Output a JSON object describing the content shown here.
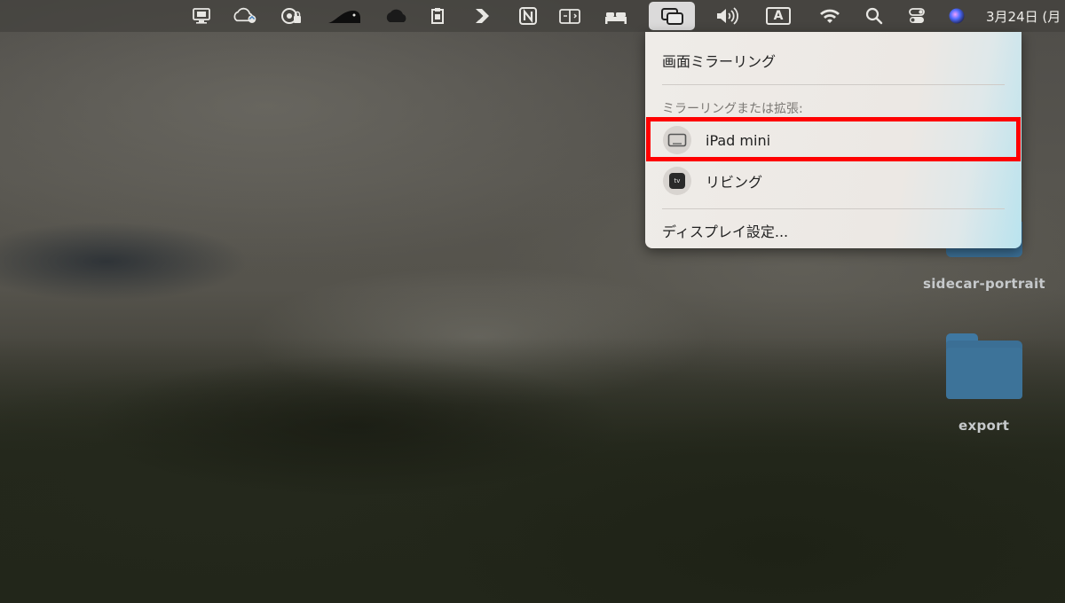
{
  "menubar": {
    "icons": [
      "display-icon",
      "cloud-sync-icon",
      "location-lock-icon",
      "wedge-icon",
      "cloud-icon",
      "clipboard-icon",
      "arrow-icon",
      "notion-icon",
      "split-view-icon",
      "bed-icon",
      "screen-mirroring-icon",
      "volume-icon",
      "input-source-icon",
      "wifi-icon",
      "search-icon",
      "control-center-icon",
      "siri-icon"
    ],
    "input_source": "A",
    "clock": "3月24日 (月"
  },
  "panel": {
    "title": "画面ミラーリング",
    "section_label": "ミラーリングまたは拡張:",
    "devices": [
      {
        "label": "iPad mini",
        "icon": "ipad-icon"
      },
      {
        "label": "リビング",
        "icon": "apple-tv-icon",
        "badge": "tv"
      }
    ],
    "settings_label": "ディスプレイ設定..."
  },
  "desktop": {
    "items": [
      {
        "label": "sidecar-portrait"
      },
      {
        "label": "export"
      }
    ]
  },
  "colors": {
    "highlight": "#ff0000",
    "folder": "#3b6f95"
  }
}
